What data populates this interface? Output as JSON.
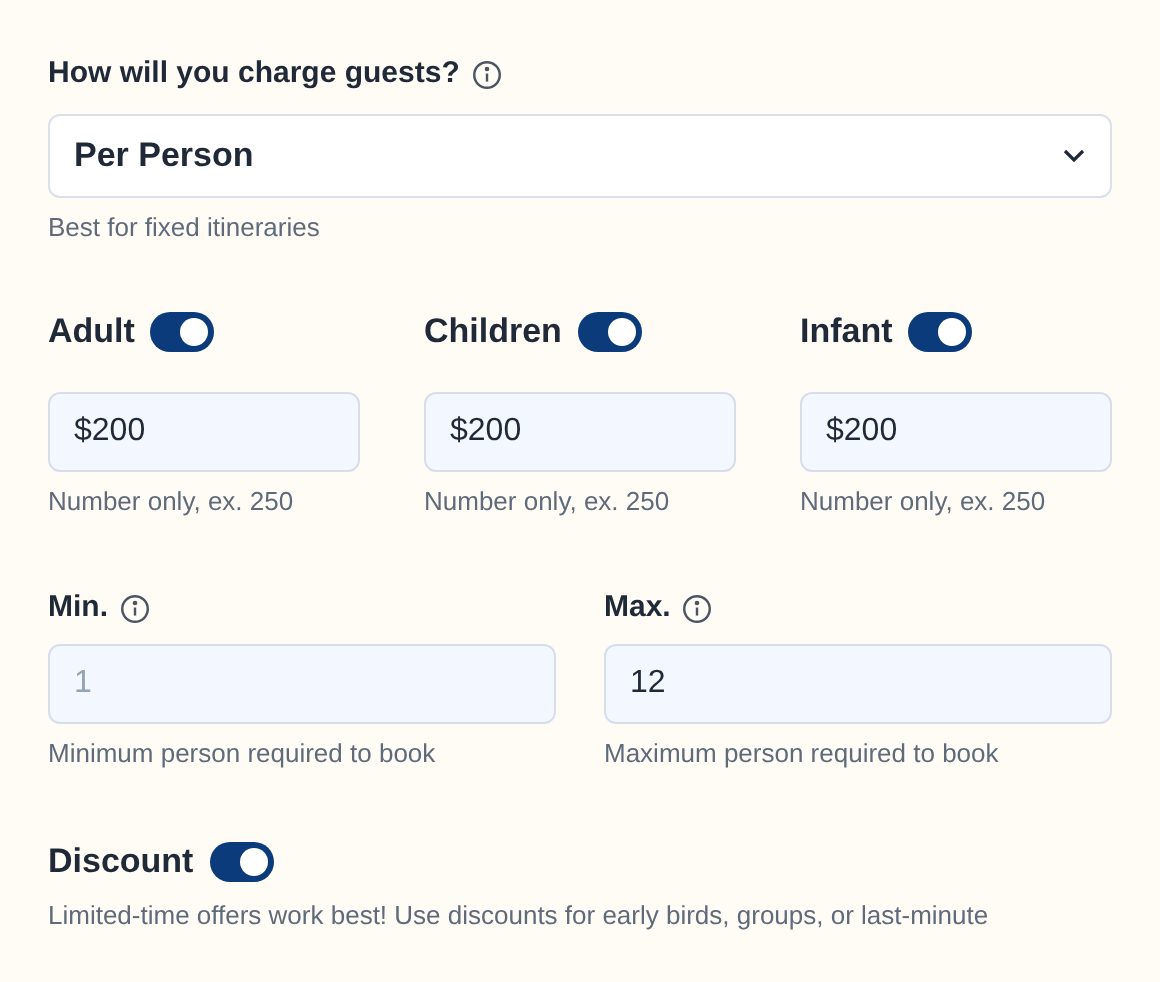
{
  "charge": {
    "label": "How will you charge guests?",
    "value": "Per Person",
    "help": "Best for fixed itineraries"
  },
  "prices": [
    {
      "label": "Adult",
      "on": true,
      "value": "$200",
      "help": "Number only, ex. 250"
    },
    {
      "label": "Children",
      "on": true,
      "value": "$200",
      "help": "Number only, ex. 250"
    },
    {
      "label": "Infant",
      "on": true,
      "value": "$200",
      "help": "Number only, ex. 250"
    }
  ],
  "limits": [
    {
      "label": "Min.",
      "placeholder": "1",
      "help": "Minimum person required to book"
    },
    {
      "label": "Max.",
      "value": "12",
      "help": "Maximum person required to book"
    }
  ],
  "discount": {
    "label": "Discount",
    "on": true,
    "help": "Limited-time offers work best! Use discounts for early birds, groups, or last-minute"
  }
}
